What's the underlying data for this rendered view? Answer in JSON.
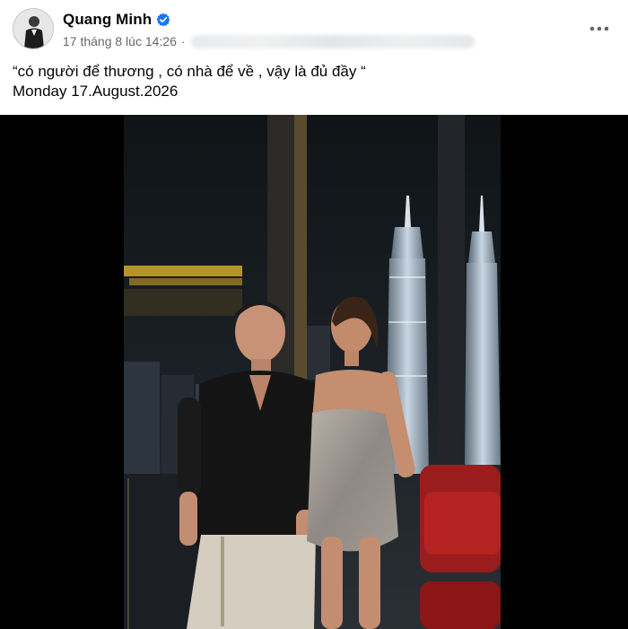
{
  "post": {
    "author": {
      "name": "Quang Minh",
      "verified": true
    },
    "timestamp": "17 tháng 8 lúc 14:26",
    "caption": {
      "line1": "“có người để thương , có nhà để về , vậy là đủ đầy “",
      "line2": "Monday 17.August.2026"
    },
    "more_icon": "more-horizontal-icon",
    "verified_icon": "verified-badge-icon"
  },
  "colors": {
    "verified_blue": "#1877f2",
    "meta_gray": "#65676b",
    "media_bg": "#000000"
  }
}
